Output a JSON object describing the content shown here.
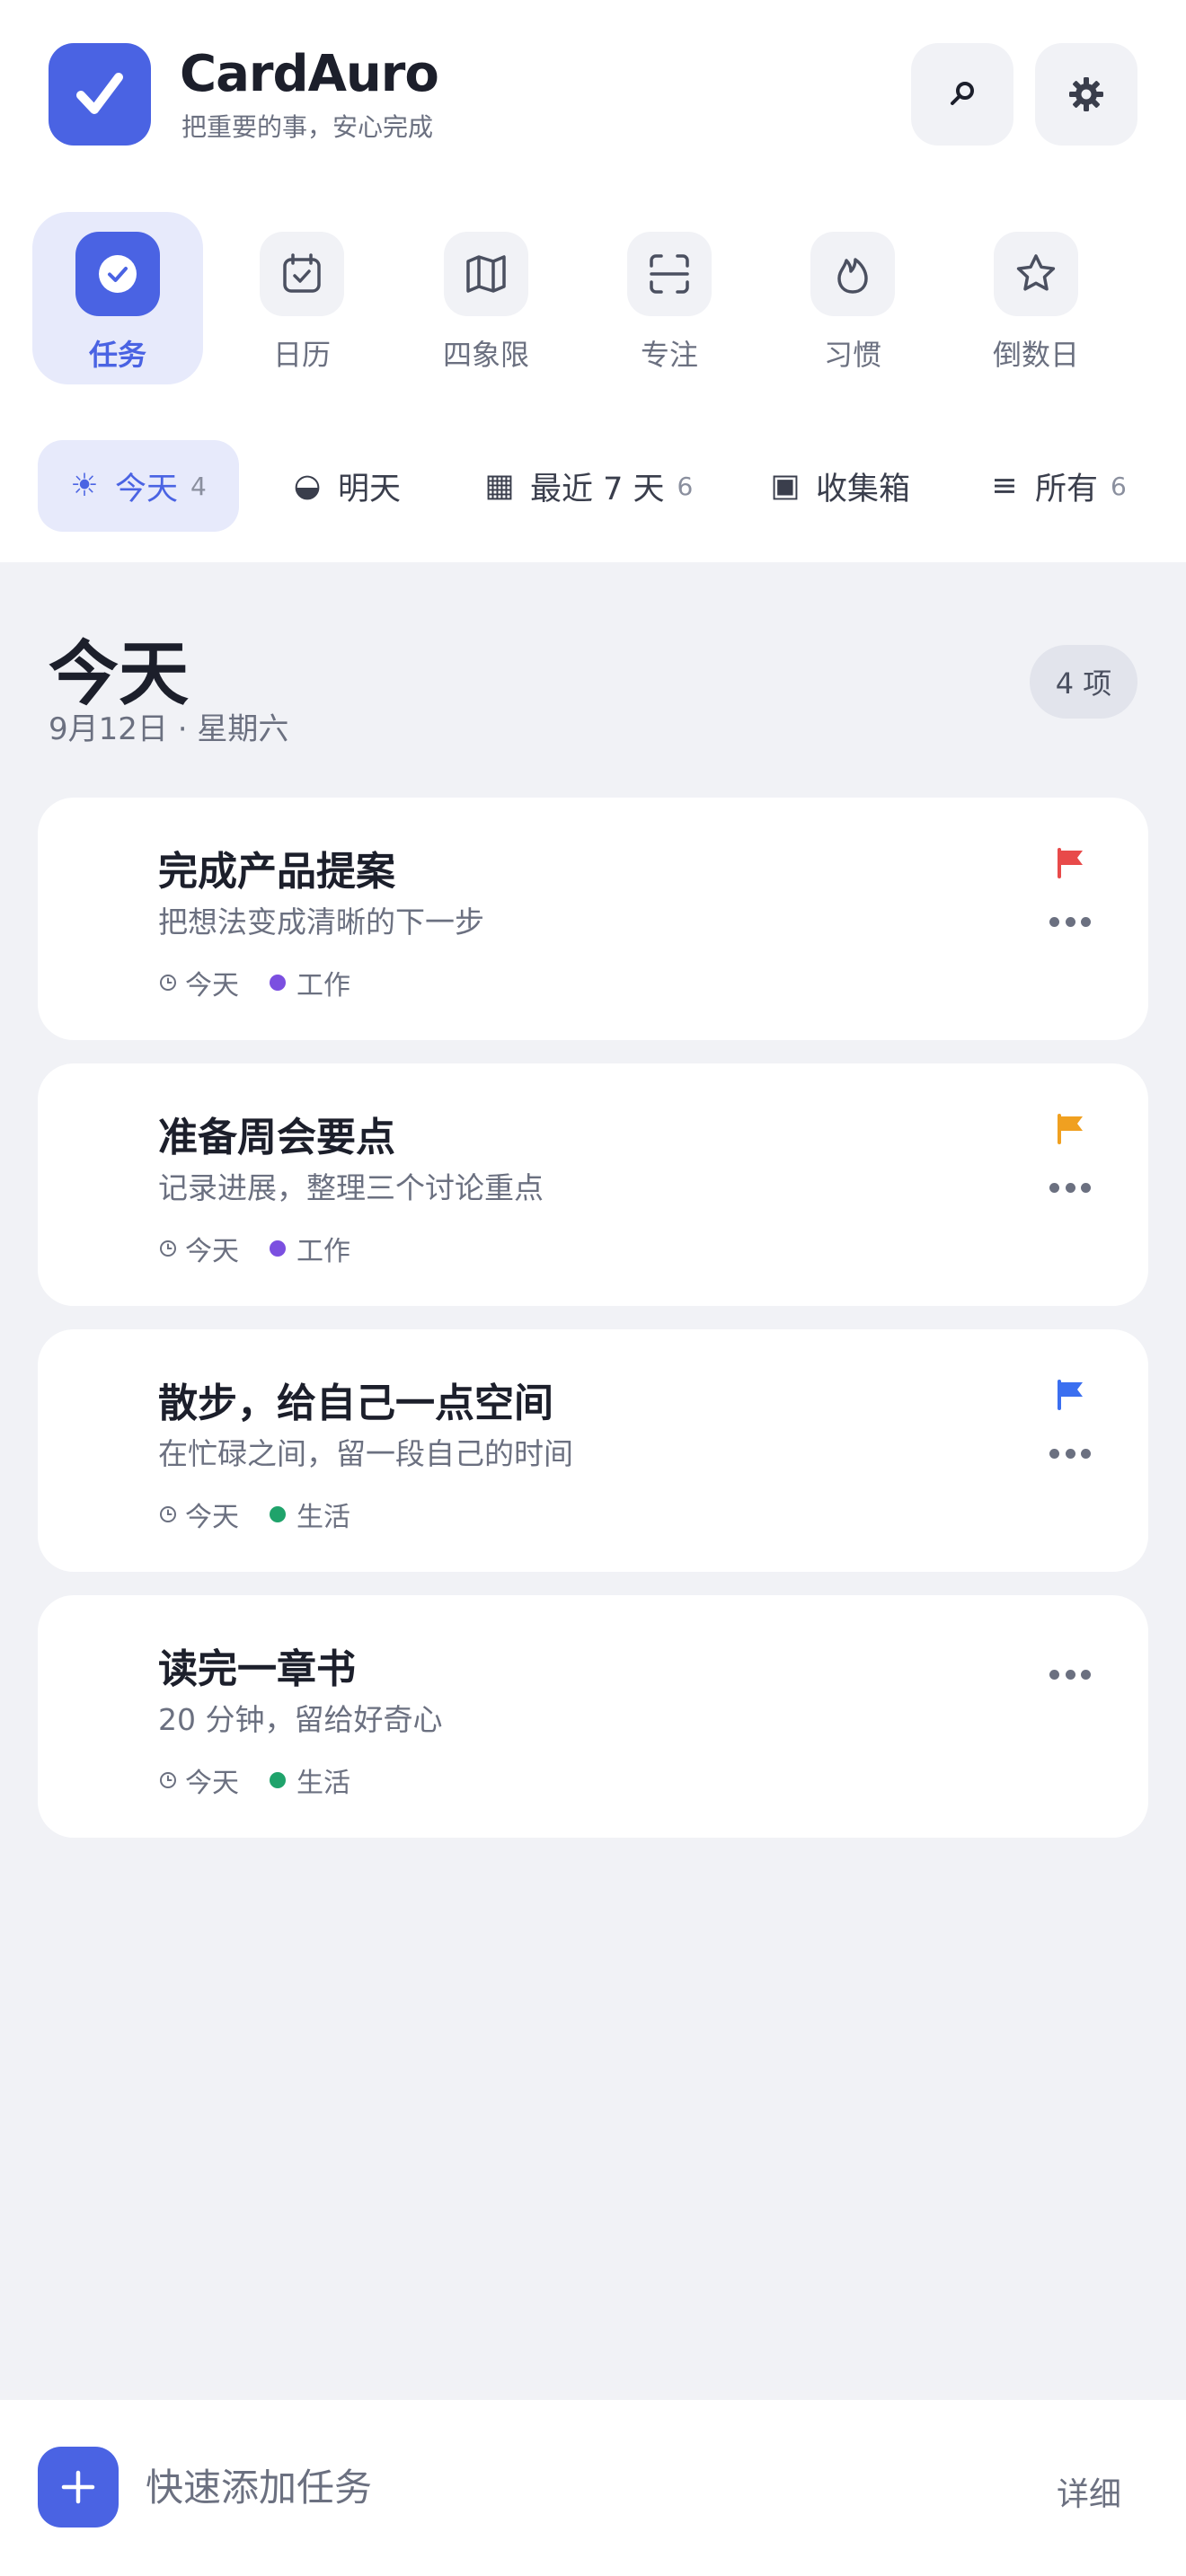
{
  "app": {
    "name": "CardAuro",
    "tagline": "把重要的事，安心完成"
  },
  "header": {
    "search_icon": "search-icon",
    "settings_icon": "gear-icon"
  },
  "nav": {
    "items": [
      {
        "label": "任务",
        "icon": "check-circle-icon",
        "active": true
      },
      {
        "label": "日历",
        "icon": "calendar-check-icon",
        "active": false
      },
      {
        "label": "四象限",
        "icon": "map-icon",
        "active": false
      },
      {
        "label": "专注",
        "icon": "focus-frame-icon",
        "active": false
      },
      {
        "label": "习惯",
        "icon": "flame-icon",
        "active": false
      },
      {
        "label": "倒数日",
        "icon": "star-icon",
        "active": false
      }
    ]
  },
  "filters": [
    {
      "icon": "☀",
      "label": "今天",
      "count": "4",
      "active": true
    },
    {
      "icon": "◒",
      "label": "明天",
      "count": "",
      "active": false
    },
    {
      "icon": "▦",
      "label": "最近 7 天",
      "count": "6",
      "active": false
    },
    {
      "icon": "▣",
      "label": "收集箱",
      "count": "",
      "active": false
    },
    {
      "icon": "≡",
      "label": "所有",
      "count": "6",
      "active": false
    }
  ],
  "section": {
    "title": "今天",
    "date": "9月12日 · 星期六",
    "count_label": "4 项"
  },
  "tasks": [
    {
      "title": "完成产品提案",
      "desc": "把想法变成清晰的下一步",
      "due": "今天",
      "tag": "工作",
      "tag_color": "#7b4fe0",
      "flag_color": "#e84a4a"
    },
    {
      "title": "准备周会要点",
      "desc": "记录进展，整理三个讨论重点",
      "due": "今天",
      "tag": "工作",
      "tag_color": "#7b4fe0",
      "flag_color": "#f0a020"
    },
    {
      "title": "散步，给自己一点空间",
      "desc": "在忙碌之间，留一段自己的时间",
      "due": "今天",
      "tag": "生活",
      "tag_color": "#1fa36b",
      "flag_color": "#3b6ff0"
    },
    {
      "title": "读完一章书",
      "desc": "20 分钟，留给好奇心",
      "due": "今天",
      "tag": "生活",
      "tag_color": "#1fa36b",
      "flag_color": ""
    }
  ],
  "bottom": {
    "quick_add_placeholder": "快速添加任务",
    "detail_label": "详细"
  },
  "colors": {
    "accent": "#4a63e3",
    "accent_soft": "#e7eafb",
    "background": "#f1f2f6"
  }
}
